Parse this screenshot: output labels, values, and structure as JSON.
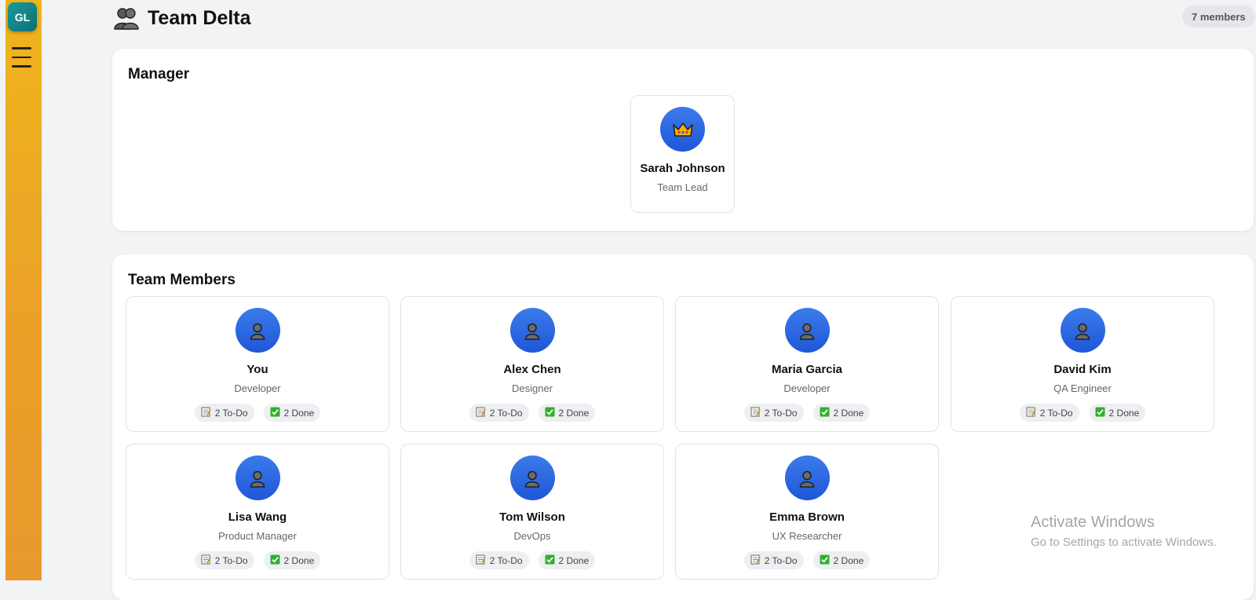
{
  "sidebar": {
    "logo_text": "GL",
    "menu_icon": "hamburger-icon"
  },
  "header": {
    "icon": "team-icon",
    "title": "Team Delta",
    "member_count": "7 members"
  },
  "manager_section": {
    "title": "Manager",
    "manager": {
      "name": "Sarah Johnson",
      "role": "Team Lead",
      "avatar_icon": "crown-icon"
    }
  },
  "members_section": {
    "title": "Team Members",
    "members": [
      {
        "name": "You",
        "role": "Developer",
        "todo": "2 To-Do",
        "done": "2 Done"
      },
      {
        "name": "Alex Chen",
        "role": "Designer",
        "todo": "2 To-Do",
        "done": "2 Done"
      },
      {
        "name": "Maria Garcia",
        "role": "Developer",
        "todo": "2 To-Do",
        "done": "2 Done"
      },
      {
        "name": "David Kim",
        "role": "QA Engineer",
        "todo": "2 To-Do",
        "done": "2 Done"
      },
      {
        "name": "Lisa Wang",
        "role": "Product Manager",
        "todo": "2 To-Do",
        "done": "2 Done"
      },
      {
        "name": "Tom Wilson",
        "role": "DevOps",
        "todo": "2 To-Do",
        "done": "2 Done"
      },
      {
        "name": "Emma Brown",
        "role": "UX Researcher",
        "todo": "2 To-Do",
        "done": "2 Done"
      }
    ]
  },
  "watermark": {
    "line1": "Activate Windows",
    "line2": "Go to Settings to activate Windows."
  },
  "colors": {
    "sidebar": "#eba128",
    "avatar": "#2563eb",
    "logo": "#148587"
  }
}
